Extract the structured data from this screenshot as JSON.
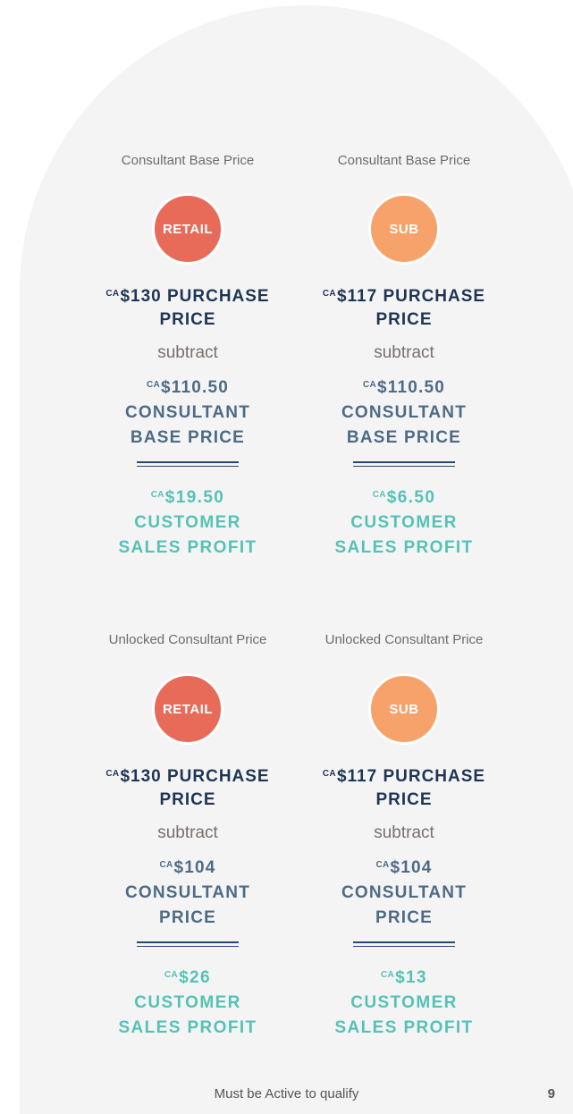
{
  "colors": {
    "retail": "#e86a58",
    "sub": "#f7a26a",
    "purchase_text": "#1e3555",
    "base_text": "#4e6b86",
    "profit_text": "#55c2b6",
    "panel_bg": "#f4f4f4"
  },
  "sections": [
    {
      "columns": [
        {
          "label": "Consultant Base Price",
          "badge": "RETAIL",
          "purchase_currency": "CA",
          "purchase_amount": "$130 PURCHASE",
          "purchase_line2": "PRICE",
          "subtract": "subtract",
          "base_currency": "CA",
          "base_amount": "$110.50",
          "base_line1": "CONSULTANT",
          "base_line2": "BASE PRICE",
          "profit_currency": "CA",
          "profit_amount": "$19.50",
          "profit_line1": "CUSTOMER",
          "profit_line2": "SALES PROFIT"
        },
        {
          "label": "Consultant Base Price",
          "badge": "SUB",
          "purchase_currency": "CA",
          "purchase_amount": "$117 PURCHASE",
          "purchase_line2": "PRICE",
          "subtract": "subtract",
          "base_currency": "CA",
          "base_amount": "$110.50",
          "base_line1": "CONSULTANT",
          "base_line2": "BASE PRICE",
          "profit_currency": "CA",
          "profit_amount": "$6.50",
          "profit_line1": "CUSTOMER",
          "profit_line2": "SALES PROFIT"
        }
      ]
    },
    {
      "columns": [
        {
          "label": "Unlocked Consultant Price",
          "badge": "RETAIL",
          "purchase_currency": "CA",
          "purchase_amount": "$130 PURCHASE",
          "purchase_line2": "PRICE",
          "subtract": "subtract",
          "base_currency": "CA",
          "base_amount": "$104",
          "base_line1": "CONSULTANT",
          "base_line2": "PRICE",
          "profit_currency": "CA",
          "profit_amount": "$26",
          "profit_line1": "CUSTOMER",
          "profit_line2": "SALES PROFIT"
        },
        {
          "label": "Unlocked Consultant Price",
          "badge": "SUB",
          "purchase_currency": "CA",
          "purchase_amount": "$117 PURCHASE",
          "purchase_line2": "PRICE",
          "subtract": "subtract",
          "base_currency": "CA",
          "base_amount": "$104",
          "base_line1": "CONSULTANT",
          "base_line2": "PRICE",
          "profit_currency": "CA",
          "profit_amount": "$13",
          "profit_line1": "CUSTOMER",
          "profit_line2": "SALES PROFIT"
        }
      ]
    }
  ],
  "footer": {
    "text": "Must be Active to qualify",
    "page_number": "9"
  }
}
